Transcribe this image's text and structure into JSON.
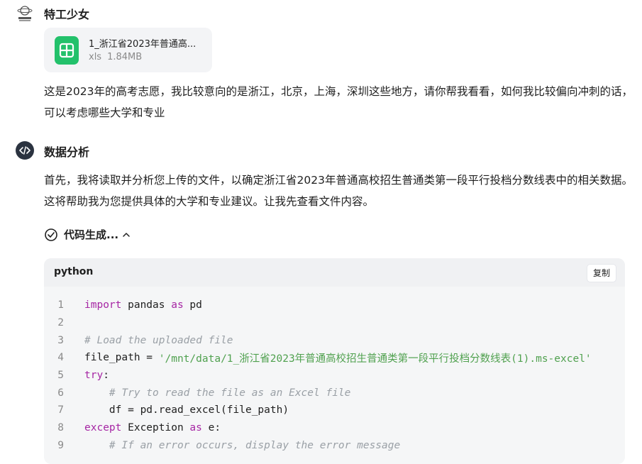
{
  "user": {
    "name": "特工少女",
    "file": {
      "name": "1_浙江省2023年普通高...",
      "ext": "xls",
      "size": "1.84MB"
    },
    "message": "这是2023年的高考志愿，我比较意向的是浙江，北京，上海，深圳这些地方，请你帮我看看，如何我比较偏向冲刺的话，可以考虑哪些大学和专业"
  },
  "agent": {
    "name": "数据分析",
    "message": "首先，我将读取并分析您上传的文件，以确定浙江省2023年普通高校招生普通类第一段平行投档分数线表中的相关数据。这将帮助我为您提供具体的大学和专业建议。让我先查看文件内容。",
    "code_status": "代码生成...",
    "code": {
      "language": "python",
      "copy_label": "复制",
      "lines": [
        {
          "n": "1",
          "t1": "import",
          "t2": " pandas ",
          "t3": "as",
          "t4": " pd"
        },
        {
          "n": "2"
        },
        {
          "n": "3",
          "comment": "# Load the uploaded file"
        },
        {
          "n": "4",
          "pre": "file_path = ",
          "str": "'/mnt/data/1_浙江省2023年普通高校招生普通类第一段平行投档分数线表(1).ms-excel'"
        },
        {
          "n": "5",
          "kw": "try",
          "rest": ":"
        },
        {
          "n": "6",
          "indent": "    ",
          "comment": "# Try to read the file as an Excel file"
        },
        {
          "n": "7",
          "indent": "    ",
          "text": "df = pd.read_excel(file_path)"
        },
        {
          "n": "8",
          "kw": "except",
          "rest": " Exception ",
          "kw2": "as",
          "rest2": " e:"
        },
        {
          "n": "9",
          "indent": "    ",
          "comment": "# If an error occurs, display the error message"
        }
      ]
    }
  }
}
